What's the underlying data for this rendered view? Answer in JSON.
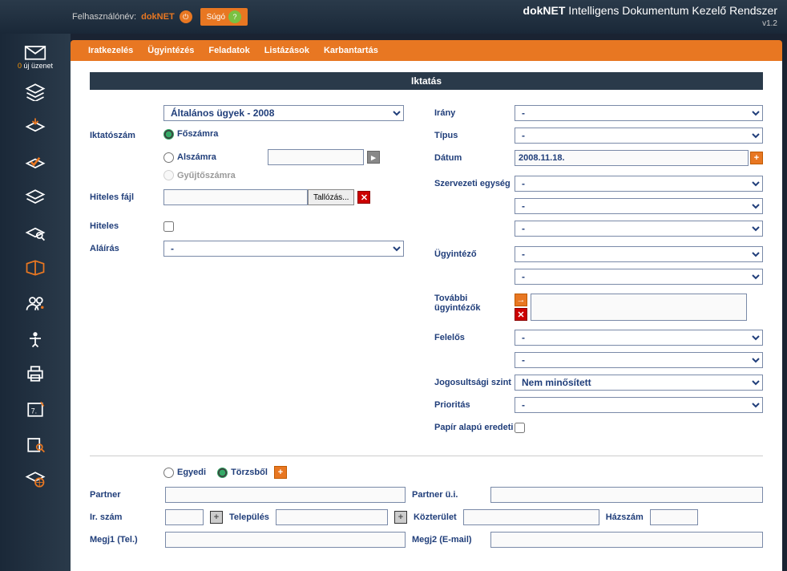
{
  "header": {
    "user_label": "Felhasználónév:",
    "username": "dokNET",
    "help": "Súgó",
    "app_bold": "dokNET",
    "app_rest": " Intelligens Dokumentum Kezelő Rendszer",
    "version": "v1.2"
  },
  "sidebar": {
    "msg_count": "0",
    "msg_text": " új üzenet"
  },
  "menu": {
    "items": [
      "Iratkezelés",
      "Ügyintézés",
      "Feladatok",
      "Listázások",
      "Karbantartás"
    ]
  },
  "panel": {
    "title": "Iktatás"
  },
  "left": {
    "book_select": "Általános ügyek - 2008",
    "iktatoszam": "Iktatószám",
    "radio_foszam": "Főszámra",
    "radio_alszam": "Alszámra",
    "radio_gyujto": "Gyűjtőszámra",
    "hiteles_fajl": "Hiteles fájl",
    "browse": "Tallózás...",
    "hiteles": "Hiteles",
    "alairas": "Aláírás",
    "alairas_value": "-"
  },
  "right": {
    "irany": "Irány",
    "irany_value": "-",
    "tipus": "Típus",
    "tipus_value": "-",
    "datum": "Dátum",
    "datum_value": "2008.11.18.",
    "szervezet": "Szervezeti egység",
    "szervezet_v1": "-",
    "szervezet_v2": "-",
    "szervezet_v3": "-",
    "ugyintezo": "Ügyintéző",
    "ugyintezo_v1": "-",
    "ugyintezo_v2": "-",
    "tovabbi": "További ügyintézők",
    "felelos": "Felelős",
    "felelos_v1": "-",
    "felelos_v2": "-",
    "jogszint": "Jogosultsági szint",
    "jogszint_value": "Nem minősített",
    "prioritas": "Prioritás",
    "prioritas_value": "-",
    "papir": "Papír alapú eredeti"
  },
  "partner": {
    "radio_egyedi": "Egyedi",
    "radio_torzs": "Törzsből",
    "partner": "Partner",
    "partner_ui": "Partner ü.i.",
    "irszam": "Ir. szám",
    "telepules": "Település",
    "kozterulet": "Közterület",
    "hazszam": "Házszám",
    "megj1": "Megj1 (Tel.)",
    "megj2": "Megj2 (E-mail)"
  }
}
